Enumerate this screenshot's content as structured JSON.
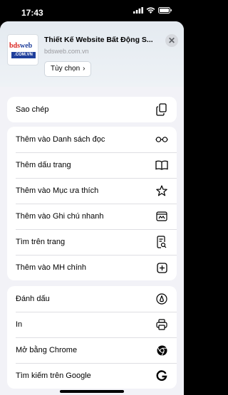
{
  "status_bar": {
    "time": "17:43"
  },
  "header": {
    "logo": {
      "line1_red": "bds",
      "line1_blue": "web",
      "line2": ".COM.VN"
    },
    "title": "Thiết Kế Website Bất Động S...",
    "url": "bdsweb.com.vn",
    "options_label": "Tùy chọn",
    "options_chevron": "›",
    "close_label": "✕"
  },
  "groups": [
    {
      "items": [
        {
          "label": "Sao chép",
          "icon": "copy-icon"
        }
      ]
    },
    {
      "items": [
        {
          "label": "Thêm vào Danh sách đọc",
          "icon": "glasses-icon"
        },
        {
          "label": "Thêm dấu trang",
          "icon": "book-icon"
        },
        {
          "label": "Thêm vào Mục ưa thích",
          "icon": "star-icon"
        },
        {
          "label": "Thêm vào Ghi chú nhanh",
          "icon": "quick-note-icon"
        },
        {
          "label": "Tìm trên trang",
          "icon": "find-in-page-icon"
        },
        {
          "label": "Thêm vào MH chính",
          "icon": "add-square-icon"
        }
      ]
    },
    {
      "items": [
        {
          "label": "Đánh dấu",
          "icon": "markup-icon"
        },
        {
          "label": "In",
          "icon": "printer-icon"
        },
        {
          "label": "Mở bằng Chrome",
          "icon": "chrome-icon"
        },
        {
          "label": "Tìm kiếm trên Google",
          "icon": "google-icon"
        }
      ]
    }
  ]
}
